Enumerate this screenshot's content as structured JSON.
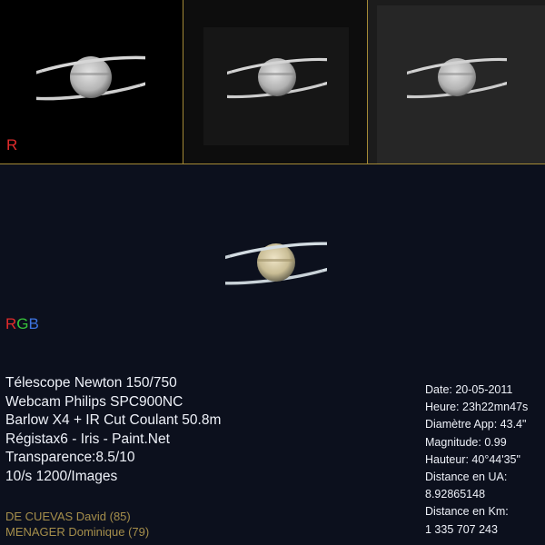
{
  "channels": {
    "r": "R",
    "g": "G",
    "b": "B",
    "rgb": [
      "R",
      "G",
      "B"
    ]
  },
  "equipment": [
    "Télescope Newton 150/750",
    "Webcam Philips SPC900NC",
    "Barlow X4 + IR Cut Coulant 50.8m",
    "Régistax6 - Iris - Paint.Net",
    "Transparence:8.5/10",
    "10/s 1200/Images"
  ],
  "credits": [
    "DE CUEVAS David (85)",
    "MENAGER Dominique (79)"
  ],
  "observation": [
    "Date: 20-05-2011",
    "Heure: 23h22mn47s",
    "Diamètre App: 43.4\"",
    "Magnitude: 0.99",
    "Hauteur: 40°44'35\"",
    "Distance en UA:",
    "8.92865148",
    "Distance en Km:",
    "1 335 707 243"
  ],
  "colors": {
    "divider": "#a58a36",
    "red": "#e12b2b",
    "green": "#37c43a",
    "blue": "#3d73e0",
    "credit_text": "#a58e4b"
  },
  "icons": [
    "saturn-planet-icon"
  ]
}
